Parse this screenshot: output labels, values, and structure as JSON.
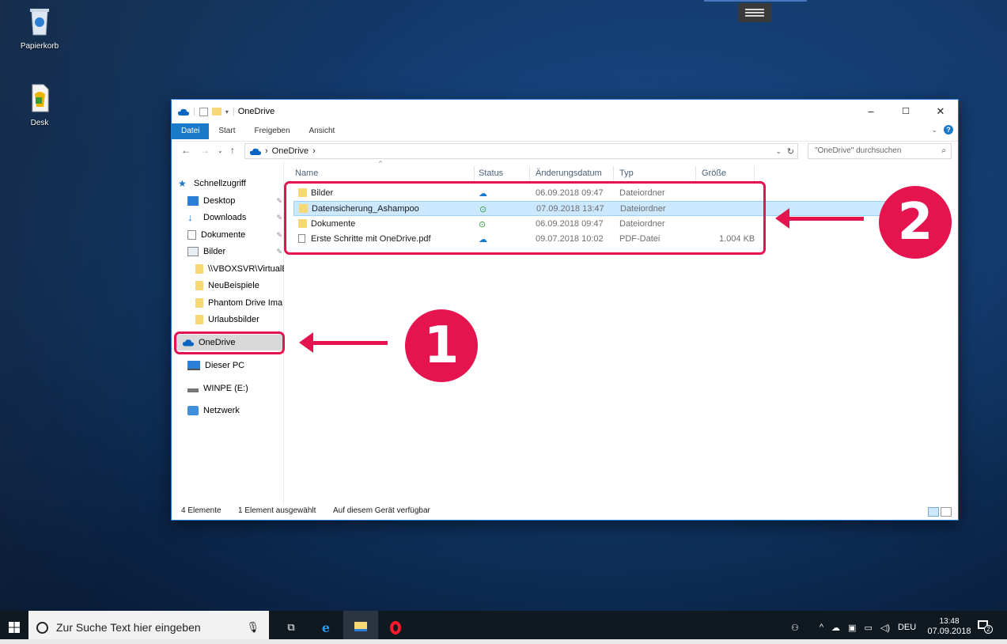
{
  "desktop": {
    "icons": [
      {
        "label": "Papierkorb",
        "icon": "recycle-bin-icon"
      },
      {
        "label": "Desk",
        "icon": "file-shortcut-icon"
      }
    ]
  },
  "window": {
    "title": "OneDrive",
    "controls": {
      "minimize": "–",
      "maximize": "☐",
      "close": "✕"
    },
    "ribbon_tabs": [
      "Datei",
      "Start",
      "Freigeben",
      "Ansicht"
    ],
    "address": {
      "root_arrow": "›",
      "crumb": "OneDrive",
      "crumb_arrow": "›"
    },
    "search_placeholder": "\"OneDrive\" durchsuchen"
  },
  "nav_pane": {
    "quick_access": "Schnellzugriff",
    "items": [
      {
        "label": "Desktop",
        "icon": "desktop-icon",
        "pinned": true
      },
      {
        "label": "Downloads",
        "icon": "download-icon",
        "pinned": true
      },
      {
        "label": "Dokumente",
        "icon": "documents-icon",
        "pinned": true
      },
      {
        "label": "Bilder",
        "icon": "pictures-icon",
        "pinned": true
      },
      {
        "label": "\\\\VBOXSVR\\VirtualE",
        "icon": "network-folder-icon",
        "pinned": false
      },
      {
        "label": "NeuBeispiele",
        "icon": "folder-icon",
        "pinned": false
      },
      {
        "label": "Phantom Drive Ima",
        "icon": "folder-icon",
        "pinned": false
      },
      {
        "label": "Urlaubsbilder",
        "icon": "folder-icon",
        "pinned": false
      }
    ],
    "onedrive": "OneDrive",
    "this_pc": "Dieser PC",
    "drive": "WINPE (E:)",
    "network": "Netzwerk"
  },
  "columns": {
    "name": "Name",
    "status": "Status",
    "date": "Änderungsdatum",
    "type": "Typ",
    "size": "Größe"
  },
  "files": [
    {
      "name": "Bilder",
      "status": "cloud",
      "date": "06.09.2018 09:47",
      "type": "Dateiordner",
      "size": "",
      "icon": "folder-icon"
    },
    {
      "name": "Datensicherung_Ashampoo",
      "status": "synced",
      "date": "07.09.2018 13:47",
      "type": "Dateiordner",
      "size": "",
      "icon": "folder-icon"
    },
    {
      "name": "Dokumente",
      "status": "synced",
      "date": "06.09.2018 09:47",
      "type": "Dateiordner",
      "size": "",
      "icon": "folder-icon"
    },
    {
      "name": "Erste Schritte mit OneDrive.pdf",
      "status": "cloud",
      "date": "09.07.2018 10:02",
      "type": "PDF-Datei",
      "size": "1.004 KB",
      "icon": "pdf-icon"
    }
  ],
  "statusbar": {
    "count": "4 Elemente",
    "selected": "1 Element ausgewählt",
    "availability": "Auf diesem Gerät verfügbar"
  },
  "annotations": {
    "badge_1": "1",
    "badge_2": "2",
    "color": "#e5144f"
  },
  "taskbar": {
    "search_placeholder": "Zur Suche Text hier eingeben",
    "language": "DEU",
    "time": "13:48",
    "date": "07.09.2018",
    "notification_count": "2"
  },
  "colors": {
    "accent": "#1979ca",
    "selection": "#cce8ff",
    "annotation": "#e5144f"
  }
}
